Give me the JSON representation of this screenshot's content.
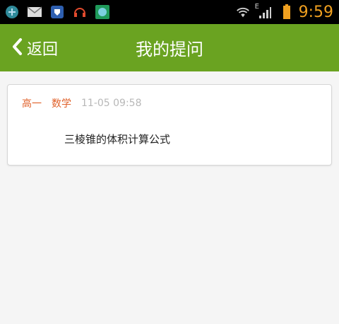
{
  "status_bar": {
    "time": "9:59",
    "network_label": "E",
    "icons": [
      "app-icon-globe",
      "mail-icon",
      "app-icon-shield",
      "headset-icon",
      "app-icon-green",
      "wifi-icon",
      "signal-icon",
      "battery-icon"
    ]
  },
  "header": {
    "back_label": "返回",
    "title": "我的提问"
  },
  "question": {
    "grade": "高一",
    "subject": "数学",
    "datetime": "11-05 09:58",
    "text": "三棱锥的体积计算公式"
  },
  "colors": {
    "header_bg": "#6aa321",
    "accent_orange": "#e0612a",
    "time_color": "#f0a020",
    "muted_text": "#b8b8b8"
  }
}
